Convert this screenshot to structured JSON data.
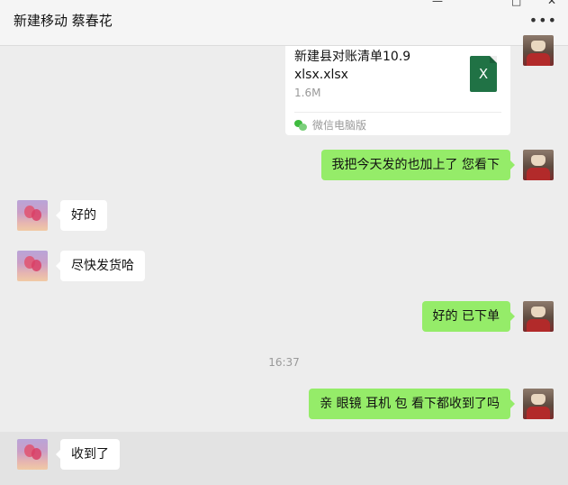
{
  "header": {
    "title": "新建移动 蔡春花",
    "minimize_glyph": "—",
    "maximize_glyph": "□",
    "close_glyph": "✕",
    "more_glyph": "•••"
  },
  "messages": [
    {
      "type": "file",
      "direction": "out",
      "file_name": "新建县对账清单10.9 xlsx.xlsx",
      "file_size": "1.6M",
      "file_icon": "xlsx-icon",
      "file_icon_letter": "X",
      "source": "微信电脑版"
    },
    {
      "type": "text",
      "direction": "out",
      "text": "我把今天发的也加上了 您看下"
    },
    {
      "type": "text",
      "direction": "in",
      "text": "好的"
    },
    {
      "type": "text",
      "direction": "in",
      "text": "尽快发货哈"
    },
    {
      "type": "text",
      "direction": "out",
      "text": "好的 已下单"
    },
    {
      "type": "time",
      "text": "16:37"
    },
    {
      "type": "text",
      "direction": "out",
      "text": "亲 眼镜 耳机 包 看下都收到了吗"
    },
    {
      "type": "text",
      "direction": "in",
      "text": "收到了"
    }
  ],
  "colors": {
    "background": "#ededed",
    "outgoing_bubble": "#95ec69",
    "incoming_bubble": "#ffffff",
    "excel_green": "#207245"
  }
}
